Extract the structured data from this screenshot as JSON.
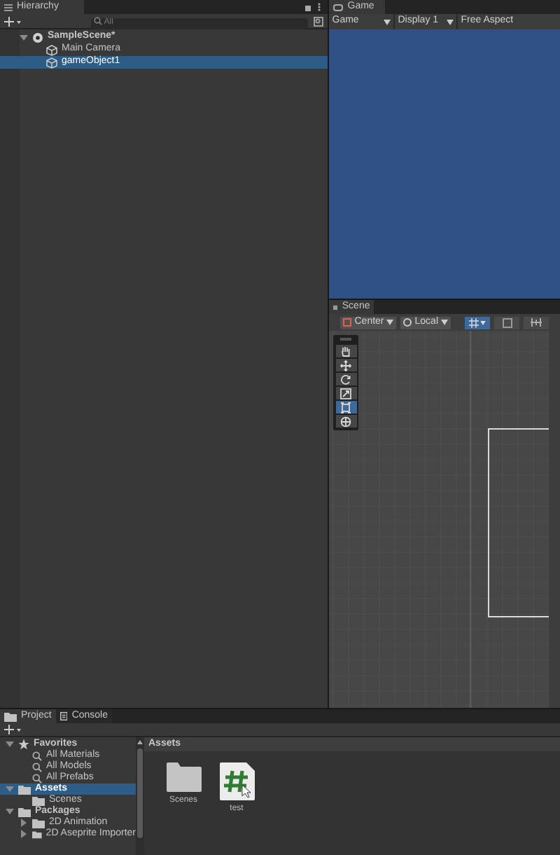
{
  "hierarchy": {
    "tab": "Hierarchy",
    "search": {
      "placeholder": "All"
    },
    "tree": [
      {
        "label": "SampleScene*",
        "kind": "scene",
        "expanded": true,
        "selected": false,
        "children": [
          {
            "label": "Main Camera",
            "kind": "object",
            "selected": false
          },
          {
            "label": "gameObject1",
            "kind": "object",
            "selected": true
          }
        ]
      }
    ]
  },
  "game": {
    "tab": "Game",
    "mode": "Game",
    "display": "Display 1",
    "aspect": "Free Aspect"
  },
  "scene": {
    "tab": "Scene",
    "pivot": "Center",
    "space": "Local",
    "tools": [
      {
        "kind": "hand",
        "selected": false
      },
      {
        "kind": "move",
        "selected": false
      },
      {
        "kind": "rotate",
        "selected": false
      },
      {
        "kind": "scale",
        "selected": false
      },
      {
        "kind": "rect",
        "selected": true
      },
      {
        "kind": "transform",
        "selected": false
      }
    ]
  },
  "project": {
    "tabs": [
      {
        "label": "Project",
        "kind": "folder",
        "selected": true
      },
      {
        "label": "Console",
        "kind": "console",
        "selected": false
      }
    ],
    "tree": [
      {
        "label": "Favorites",
        "kind": "star",
        "expanded": true,
        "selected": false,
        "children": [
          {
            "label": "All Materials",
            "kind": "search",
            "selected": false
          },
          {
            "label": "All Models",
            "kind": "search",
            "selected": false
          },
          {
            "label": "All Prefabs",
            "kind": "search",
            "selected": false
          }
        ]
      },
      {
        "label": "Assets",
        "kind": "folder",
        "expanded": true,
        "selected": true,
        "children": [
          {
            "label": "Scenes",
            "kind": "folder",
            "selected": false
          }
        ]
      },
      {
        "label": "Packages",
        "kind": "folder",
        "expanded": true,
        "selected": false,
        "children": [
          {
            "label": "2D Animation",
            "kind": "folder",
            "expanded": false,
            "selected": false
          },
          {
            "label": "2D Aseprite Importer",
            "kind": "folder",
            "expanded": false,
            "selected": false
          }
        ]
      }
    ],
    "breadcrumb": "Assets",
    "items": [
      {
        "label": "Scenes",
        "kind": "folder"
      },
      {
        "label": "test",
        "kind": "script"
      }
    ]
  }
}
